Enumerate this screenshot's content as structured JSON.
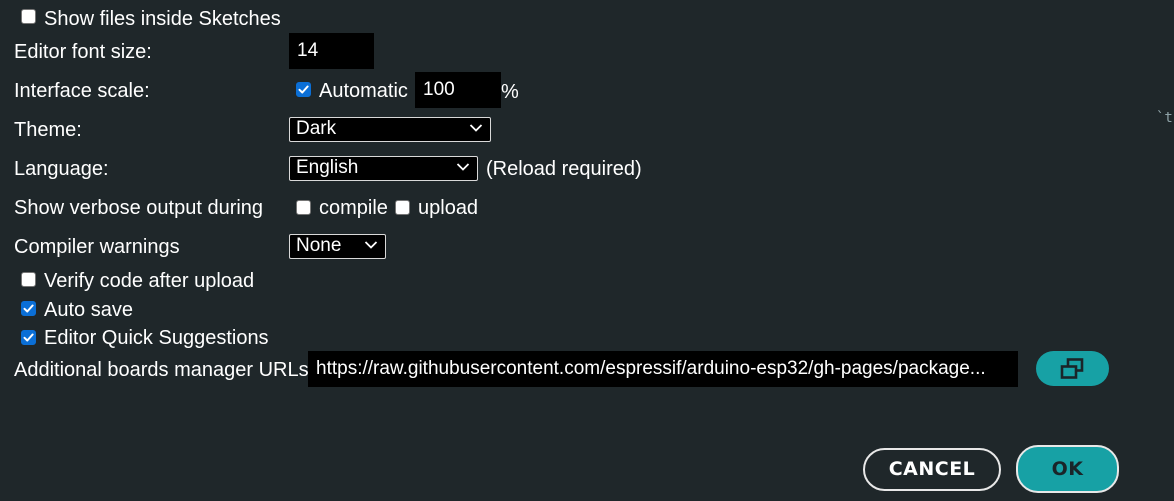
{
  "show_files_inside_sketches": {
    "label": "Show files inside Sketches",
    "checked": false
  },
  "editor_font_size": {
    "label": "Editor font size:",
    "value": "14"
  },
  "interface_scale": {
    "label": "Interface scale:",
    "automatic_label": "Automatic",
    "automatic_checked": true,
    "value": "100",
    "unit": "%"
  },
  "theme": {
    "label": "Theme:",
    "selected": "Dark"
  },
  "language": {
    "label": "Language:",
    "selected": "English",
    "note": "(Reload required)"
  },
  "verbose": {
    "label": "Show verbose output during",
    "compile_label": "compile",
    "compile_checked": false,
    "upload_label": "upload",
    "upload_checked": false
  },
  "compiler_warnings": {
    "label": "Compiler warnings",
    "selected": "None"
  },
  "verify_code": {
    "label": "Verify code after upload",
    "checked": false
  },
  "auto_save": {
    "label": "Auto save",
    "checked": true
  },
  "quick_suggestions": {
    "label": "Editor Quick Suggestions",
    "checked": true
  },
  "boards_urls": {
    "label": "Additional boards manager URLs:",
    "value": "https://raw.githubusercontent.com/espressif/arduino-esp32/gh-pages/package..."
  },
  "background_text": "`t",
  "buttons": {
    "cancel": "CANCEL",
    "ok": "OK"
  },
  "colors": {
    "background": "#1f272a",
    "accent": "#17a1a5",
    "checkbox_checked": "#0b6fd6"
  },
  "icons": {
    "open_urls": "window-restore-icon",
    "dropdown": "chevron-down-icon",
    "checkmark": "check-icon"
  }
}
